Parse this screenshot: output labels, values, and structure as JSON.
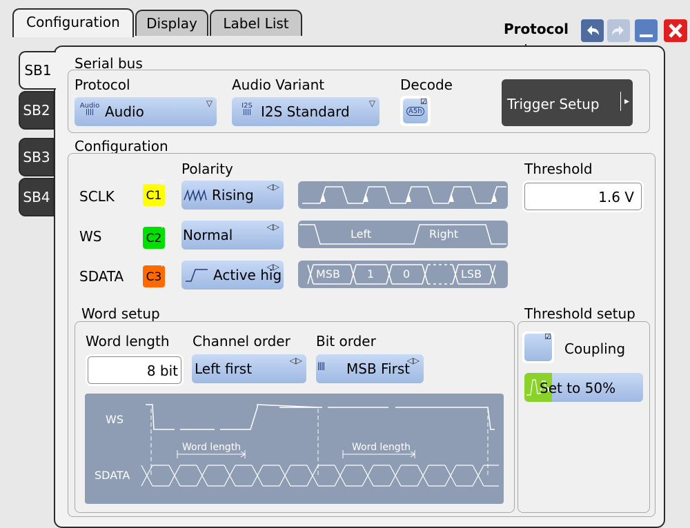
{
  "tabs": [
    {
      "label": "Configuration"
    },
    {
      "label": "Display"
    },
    {
      "label": "Label List"
    }
  ],
  "window": {
    "title": "Protocol"
  },
  "serial_buses": [
    {
      "label": "SB1"
    },
    {
      "label": "SB2"
    },
    {
      "label": "SB3"
    },
    {
      "label": "SB4"
    }
  ],
  "serial_bus": {
    "section_label": "Serial bus",
    "protocol": {
      "label": "Protocol",
      "value": "Audio",
      "icon_text": "Audio"
    },
    "audio_variant": {
      "label": "Audio Variant",
      "value": "I2S Standard",
      "icon_text": "I2S"
    },
    "decode": {
      "label": "Decode",
      "icon_text": "A5h"
    },
    "trigger_setup": {
      "label": "Trigger Setup"
    }
  },
  "configuration": {
    "section_label": "Configuration",
    "polarity_label": "Polarity",
    "threshold_label": "Threshold",
    "threshold_value": "1.6 V",
    "signals": [
      {
        "name": "SCLK",
        "channel": "C1",
        "channel_color": "#ffff00",
        "polarity": "Rising"
      },
      {
        "name": "WS",
        "channel": "C2",
        "channel_color": "#00e000",
        "polarity": "Normal"
      },
      {
        "name": "SDATA",
        "channel": "C3",
        "channel_color": "#ff6a00",
        "polarity": "Active hig"
      }
    ],
    "ws_diagram": {
      "left": "Left",
      "right": "Right"
    },
    "sdata_diagram": {
      "msb": "MSB",
      "one": "1",
      "zero": "0",
      "lsb": "LSB"
    }
  },
  "word_setup": {
    "section_label": "Word setup",
    "word_length": {
      "label": "Word length",
      "value": "8 bit"
    },
    "channel_order": {
      "label": "Channel order",
      "value": "Left first"
    },
    "bit_order": {
      "label": "Bit order",
      "value": "MSB First"
    },
    "diagram": {
      "ws_label": "WS",
      "sdata_label": "SDATA",
      "word_length_label": "Word length"
    }
  },
  "threshold_setup": {
    "section_label": "Threshold setup",
    "coupling_label": "Coupling",
    "set50_label": "Set to 50%"
  },
  "colors": {
    "accent_blue": "#9fb9e2",
    "close_red": "#e02020",
    "diagram_bg": "#8e9db4"
  }
}
